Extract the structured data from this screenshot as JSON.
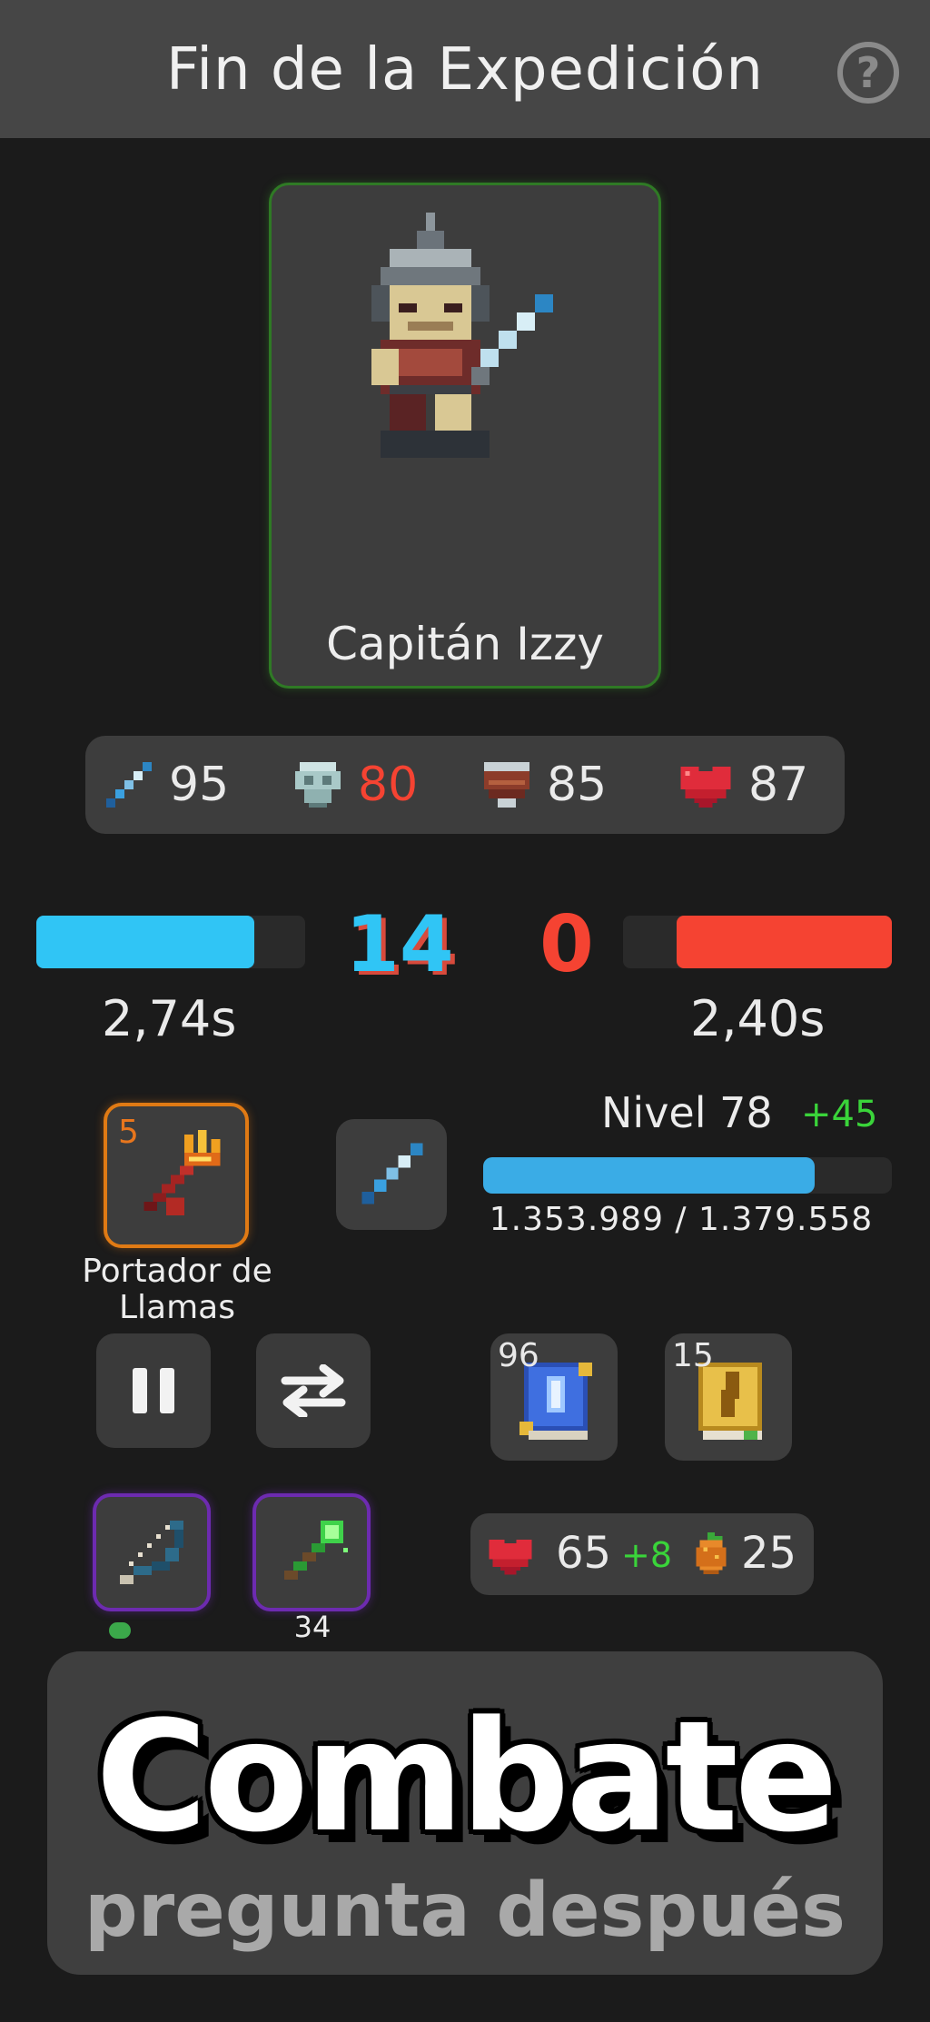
{
  "header": {
    "title": "Fin de la Expedición",
    "help_label": "?"
  },
  "hero": {
    "name": "Capitán Izzy"
  },
  "stats": {
    "attack": "95",
    "mind": "80",
    "defense": "85",
    "health": "87"
  },
  "combat": {
    "player_score": "14",
    "enemy_score": "0",
    "player_timer": "2,74s",
    "enemy_timer": "2,40s",
    "player_bar_fraction": 0.81,
    "enemy_bar_fraction": 0.8
  },
  "weapon": {
    "count": "5",
    "name": "Portador de Llamas"
  },
  "level": {
    "label": "Nivel 78",
    "gain": "+45",
    "xp_text": "1.353.989 / 1.379.558",
    "xp_fraction": 0.81
  },
  "books": [
    {
      "count": "96"
    },
    {
      "count": "15"
    }
  ],
  "items": {
    "second_count": "34"
  },
  "resources": {
    "health": "65",
    "health_gain": "+8",
    "food": "25"
  },
  "banner": {
    "title": "Combate",
    "subtitle": "pregunta después"
  },
  "colors": {
    "player": "#30c5f5",
    "enemy": "#f54332",
    "xp": "#3aace6",
    "gain": "#3ad43a",
    "weapon_border": "#e07a14",
    "item_border": "#6d2bb0",
    "hero_border": "#2f7a25"
  }
}
